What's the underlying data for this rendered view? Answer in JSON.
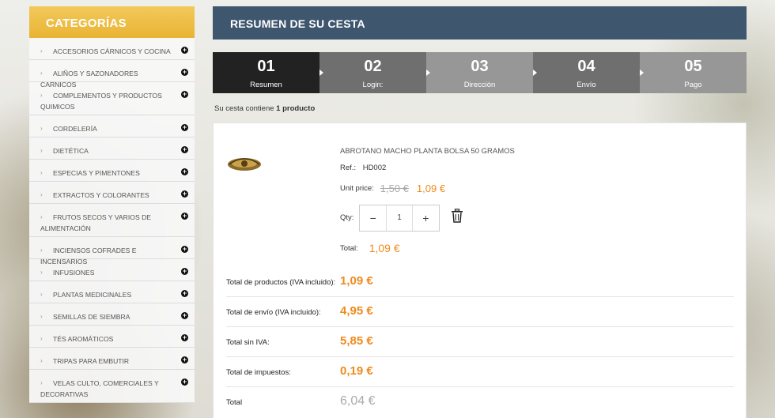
{
  "sidebar": {
    "title": "CATEGORÍAS",
    "items": [
      {
        "label": "ACCESORIOS CÁRNICOS Y COCINA"
      },
      {
        "label": "ALIÑOS Y SAZONADORES CARNICOS"
      },
      {
        "label": "COMPLEMENTOS Y PRODUCTOS QUIMICOS"
      },
      {
        "label": "CORDELERÍA"
      },
      {
        "label": "DIETÉTICA"
      },
      {
        "label": "ESPECIAS Y PIMENTONES"
      },
      {
        "label": "EXTRACTOS Y COLORANTES"
      },
      {
        "label": "FRUTOS SECOS Y VARIOS DE ALIMENTACIÓN"
      },
      {
        "label": "INCIENSOS COFRADES E INCENSARIOS"
      },
      {
        "label": "INFUSIONES"
      },
      {
        "label": "PLANTAS MEDICINALES"
      },
      {
        "label": "SEMILLAS DE SIEMBRA"
      },
      {
        "label": "TÉS AROMÁTICOS"
      },
      {
        "label": "TRIPAS PARA EMBUTIR"
      },
      {
        "label": "VELAS CULTO, COMERCIALES Y DECORATIVAS"
      }
    ]
  },
  "header": {
    "title": "RESUMEN DE SU CESTA"
  },
  "steps": [
    {
      "num": "01",
      "label": "Resumen",
      "color": "#222222"
    },
    {
      "num": "02",
      "label": "Login:",
      "color": "#6f6f6f"
    },
    {
      "num": "03",
      "label": "Dirección",
      "color": "#979797"
    },
    {
      "num": "04",
      "label": "Envío",
      "color": "#6f6f6f"
    },
    {
      "num": "05",
      "label": "Pago",
      "color": "#979797"
    }
  ],
  "cart": {
    "note_prefix": "Su cesta contiene ",
    "note_count": "1 producto",
    "product": {
      "name": "ABROTANO MACHO PLANTA BOLSA 50 GRAMOS",
      "ref_label": "Ref.:",
      "ref_value": "HD002",
      "unit_price_label": "Unit price:",
      "old_price": "1,50 €",
      "price": "1,09 €",
      "qty_label": "Qty:",
      "qty_minus": "−",
      "qty_value": "1",
      "qty_plus": "+",
      "total_label": "Total:",
      "total_value": "1,09 €"
    },
    "totals": [
      {
        "label": "Total de productos (IVA incluido):",
        "value": "1,09 €"
      },
      {
        "label": "Total de envío (IVA incluido):",
        "value": "4,95 €"
      },
      {
        "label": "Total sin IVA:",
        "value": "5,85 €"
      },
      {
        "label": "Total de impuestos:",
        "value": "0,19 €"
      },
      {
        "label": "Total",
        "value": "6,04 €"
      }
    ]
  },
  "colors": {
    "accent": "#f08a1c",
    "header_bg": "#3e566e",
    "category_header": "#eebf45"
  },
  "icons": {
    "category_toggle": "plus-circle-icon",
    "delete": "trash-icon",
    "step_arrow": "triangle-right-icon"
  }
}
